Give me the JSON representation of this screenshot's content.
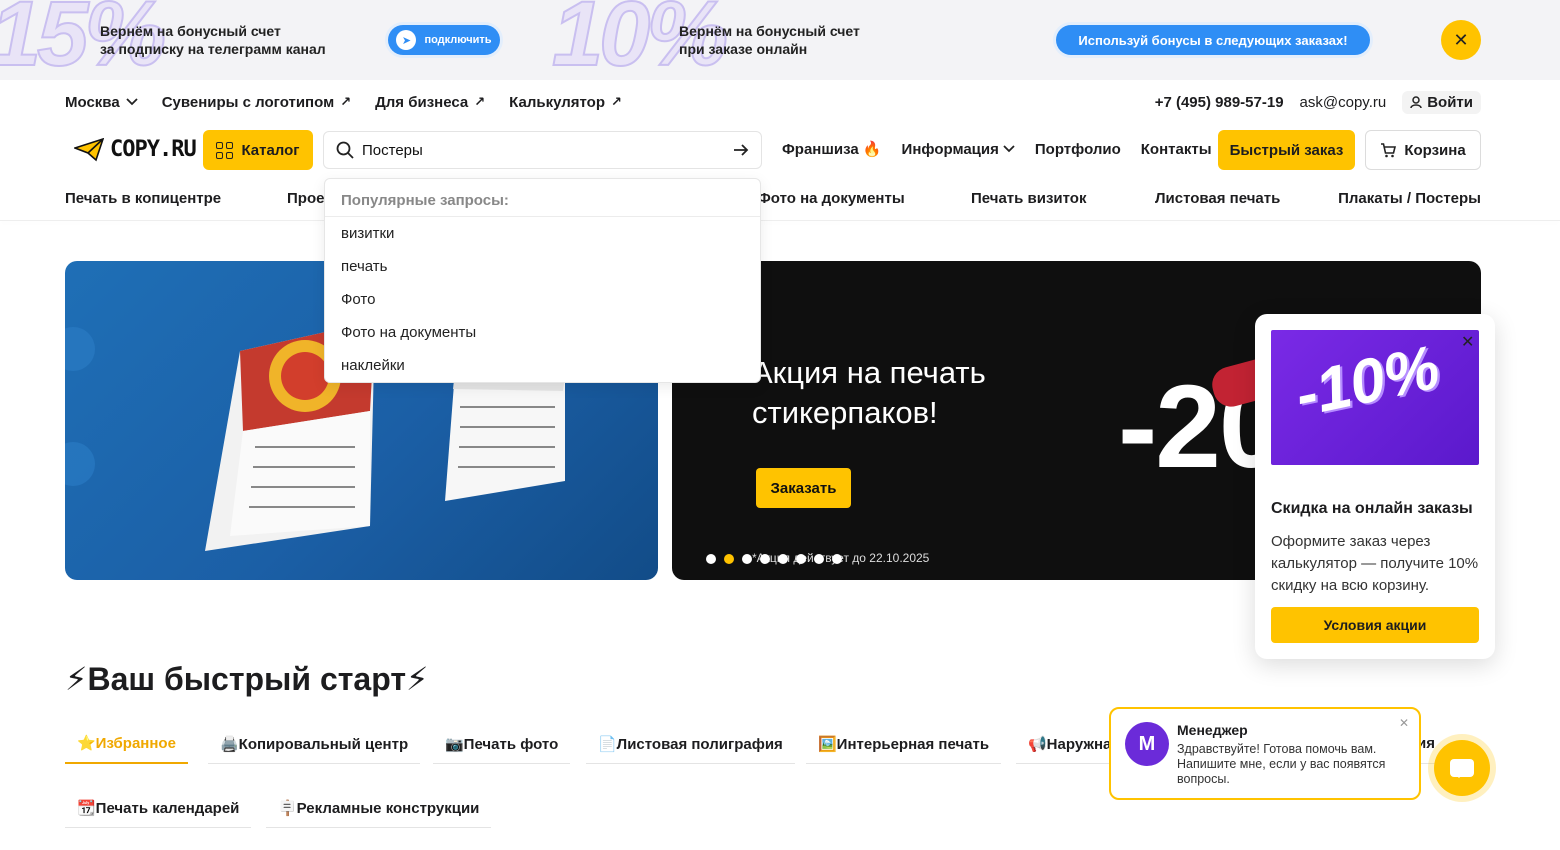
{
  "promo": {
    "num1": "15%",
    "text1a": "Вернём на бонусный счет",
    "text1b": "за подписку на телеграмм канал",
    "btn1": "подключить",
    "num2": "10%",
    "text2a": "Вернём на бонусный счет",
    "text2b": "при заказе онлайн",
    "btn2": "Используй бонусы в следующих заказах!"
  },
  "topbar": {
    "city": "Москва",
    "links": [
      "Сувениры с логотипом",
      "Для бизнеса",
      "Калькулятор"
    ],
    "phone": "+7 (495) 989-57-19",
    "email": "ask@copy.ru",
    "login": "Войти"
  },
  "header": {
    "logo": "COPY.RU",
    "catalog": "Каталог",
    "search_value": "Постеры",
    "nav": [
      "Франшиза 🔥",
      "Информация",
      "Портфолио",
      "Контакты"
    ],
    "fast_order": "Быстрый заказ",
    "cart": "Корзина"
  },
  "categories": [
    "Печать в копицентре",
    "Прое",
    "Фото на документы",
    "Печать визиток",
    "Листовая печать",
    "Плакаты / Постеры"
  ],
  "dropdown": {
    "title": "Популярные запросы:",
    "items": [
      "визитки",
      "печать",
      "Фото",
      "Фото на документы",
      "наклейки"
    ]
  },
  "banner": {
    "title_line1": "Акция на печать",
    "title_line2": "стикерпаков!",
    "button": "Заказать",
    "big": "-20",
    "note": "*Акция действует до 22.10.2025",
    "dots_count": 8,
    "active_dot": 2
  },
  "section": {
    "title": "⚡Ваш быстрый старт⚡",
    "tabs": [
      "⭐Избранное",
      "🖨️Копировальный центр",
      "📷Печать фото",
      "📄Листовая полиграфия",
      "🖼️Интерьерная печать",
      "📢Наружна",
      "ия",
      "📆Печать календарей",
      "🪧Рекламные конструкции"
    ]
  },
  "popup": {
    "image_text": "-10%",
    "title": "Скидка на онлайн заказы",
    "text": "Оформите заказ через калькулятор — получите 10% скидку на всю корзину.",
    "button": "Условия акции"
  },
  "chat": {
    "name": "Менеджер",
    "message": "Здравствуйте! Готова помочь вам. Напишите мне, если у вас появятся вопросы."
  },
  "colors": {
    "accent": "#ffc300",
    "promo_blue": "#2f8ef5",
    "purple": "#6b2bd9"
  }
}
